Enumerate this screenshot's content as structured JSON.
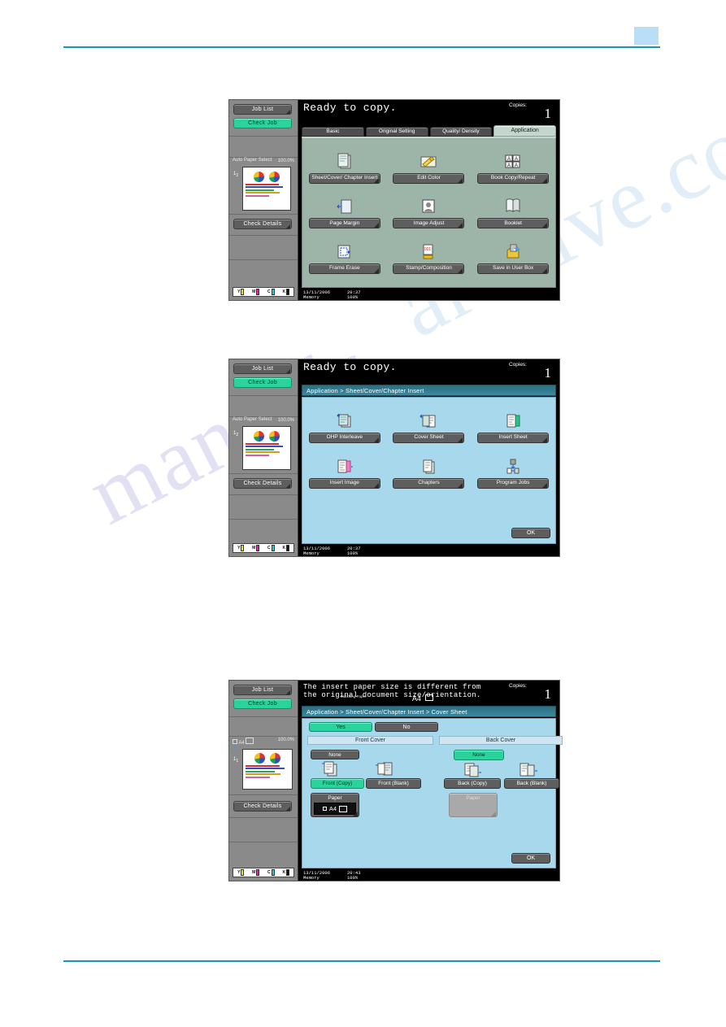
{
  "page": {
    "watermark": "manuals",
    "watermark2": "archive.co"
  },
  "common": {
    "job_list_label": "Job List",
    "check_job_label": "Check Job",
    "check_details_label": "Check Details",
    "copies_label": "Copies:",
    "copies_value": "1",
    "memory_label": "Memory",
    "memory_value": "100%",
    "date": "13/11/2006",
    "toner": [
      {
        "label": "Y",
        "color": "#e8e020"
      },
      {
        "label": "M",
        "color": "#e020b8"
      },
      {
        "label": "C",
        "color": "#20c8e0"
      },
      {
        "label": "K",
        "color": "#101010"
      }
    ]
  },
  "screen1": {
    "message": "Ready to copy.",
    "time": "20:37",
    "paper_name": "Auto Paper Select",
    "zoom": "100.0%",
    "tabs": [
      {
        "label": "Basic",
        "active": false
      },
      {
        "label": "Original Setting",
        "active": false
      },
      {
        "label": "Quality/ Density",
        "active": false
      },
      {
        "label": "Application",
        "active": true
      }
    ],
    "functions": [
      {
        "label": "Sheet/Cover/ Chapter Insert",
        "icon": "sheet-insert-icon"
      },
      {
        "label": "Edit Color",
        "icon": "edit-color-icon"
      },
      {
        "label": "Book Copy/Repeat",
        "icon": "book-copy-icon"
      },
      {
        "label": "Page Margin",
        "icon": "page-margin-icon"
      },
      {
        "label": "Image Adjust",
        "icon": "image-adjust-icon"
      },
      {
        "label": "Booklet",
        "icon": "booklet-icon"
      },
      {
        "label": "Frame Erase",
        "icon": "frame-erase-icon"
      },
      {
        "label": "Stamp/Composition",
        "icon": "stamp-composition-icon"
      },
      {
        "label": "Save in User Box",
        "icon": "save-user-box-icon"
      }
    ]
  },
  "screen2": {
    "message": "Ready to copy.",
    "time": "20:37",
    "paper_name": "Auto Paper Select",
    "zoom": "100.0%",
    "breadcrumb": "Application > Sheet/Cover/Chapter Insert",
    "ok_label": "OK",
    "functions": [
      {
        "label": "OHP Interleave",
        "icon": "ohp-interleave-icon"
      },
      {
        "label": "Cover Sheet",
        "icon": "cover-sheet-icon"
      },
      {
        "label": "Insert Sheet",
        "icon": "insert-sheet-icon"
      },
      {
        "label": "Insert Image",
        "icon": "insert-image-icon"
      },
      {
        "label": "Chapters",
        "icon": "chapters-icon"
      },
      {
        "label": "Program Jobs",
        "icon": "program-jobs-icon"
      }
    ]
  },
  "screen3": {
    "message_line1": "The insert paper size is different from",
    "message_line2": "the original document size/orientation.",
    "matching_paper_label": "Matching Paper",
    "matching_paper_size": "A4",
    "time": "20:43",
    "paper_name": "A4",
    "zoom": "100.0%",
    "breadcrumb": "Application > Sheet/Cover/Chapter Insert > Cover Sheet",
    "ok_label": "OK",
    "yes_label": "Yes",
    "no_label": "No",
    "front_cover": {
      "title": "Front Cover",
      "none_label": "None",
      "copy_label": "Front (Copy)",
      "blank_label": "Front (Blank)",
      "paper_label": "Paper",
      "paper_value": "A4",
      "selected": "copy"
    },
    "back_cover": {
      "title": "Back Cover",
      "none_label": "None",
      "copy_label": "Back  (Copy)",
      "blank_label": "Back (Blank)",
      "paper_label": "Paper",
      "selected": "none"
    }
  }
}
